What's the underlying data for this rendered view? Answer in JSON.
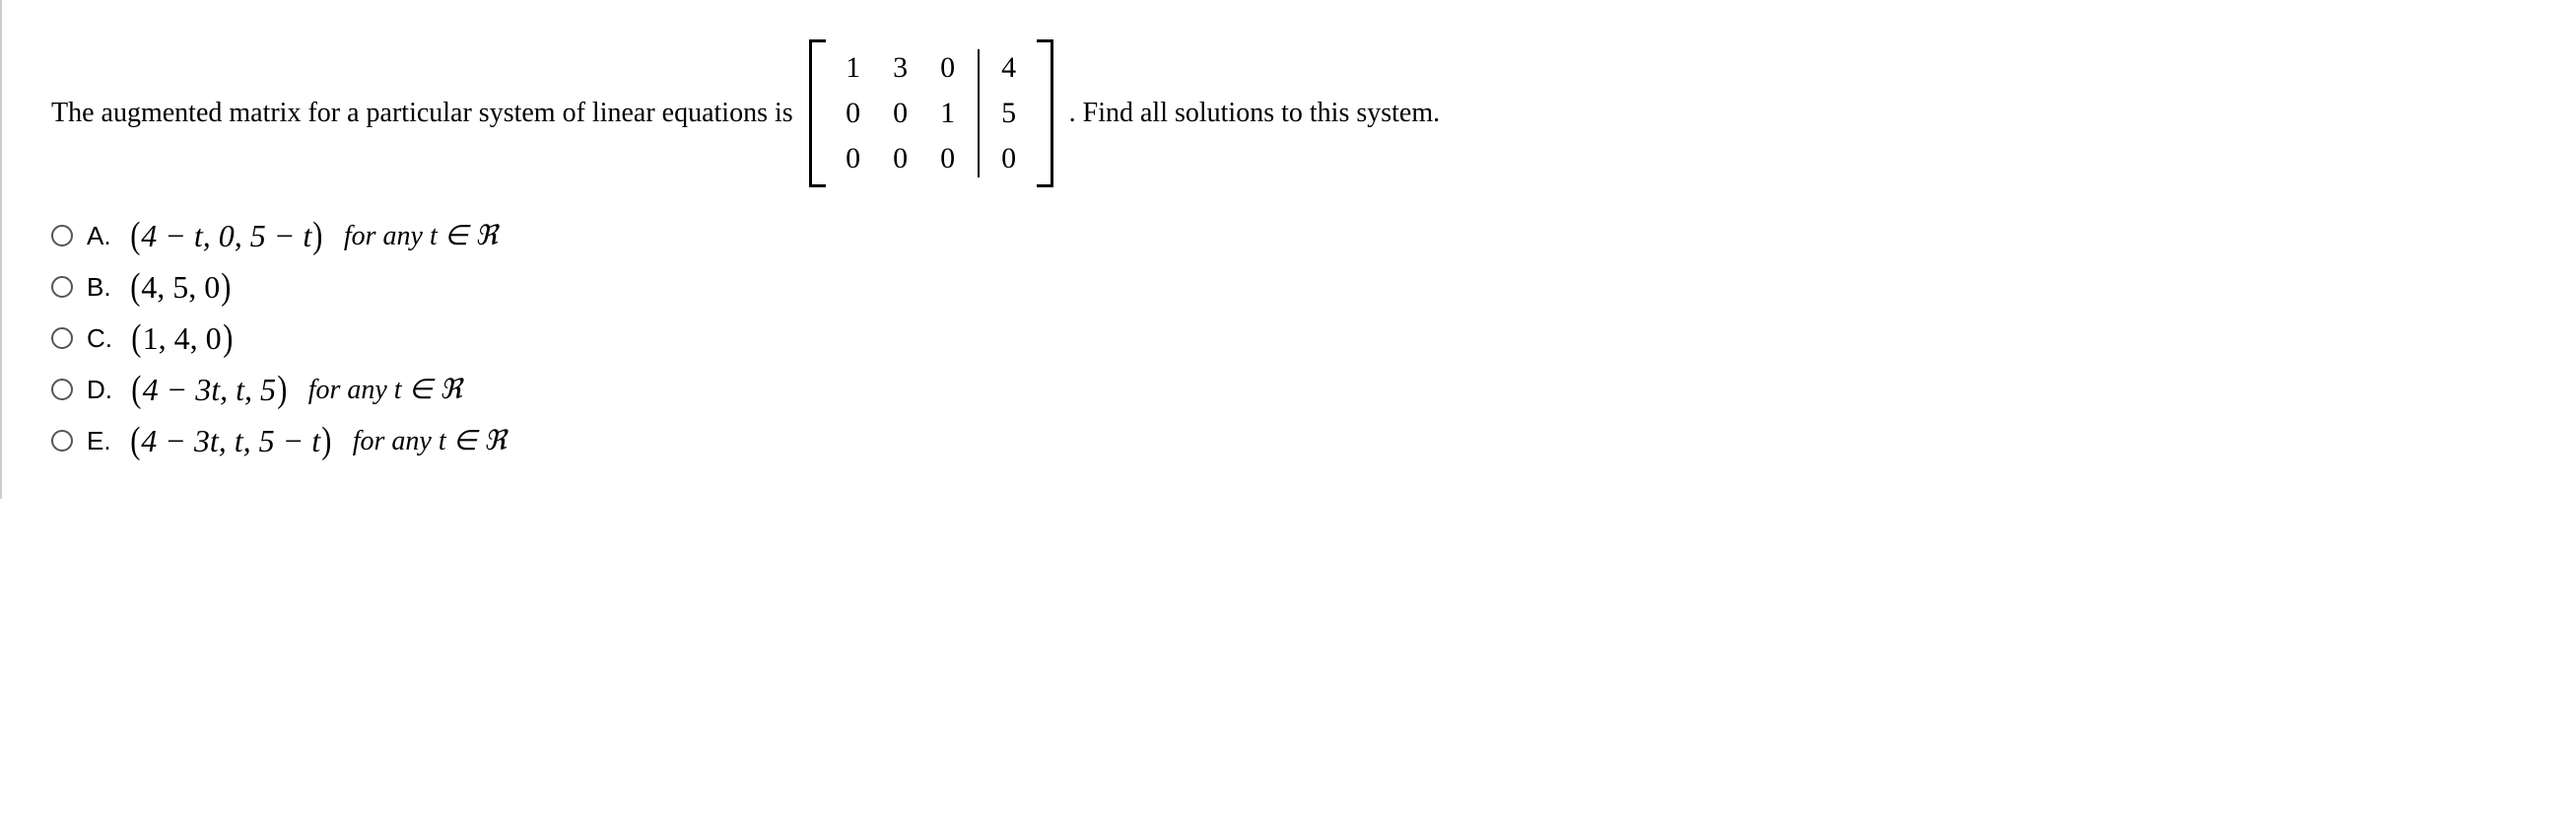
{
  "question": {
    "lead": "The augmented matrix for a particular system of linear equations is",
    "tail": ". Find all solutions to this system.",
    "matrix": {
      "left": [
        [
          "1",
          "3",
          "0"
        ],
        [
          "0",
          "0",
          "1"
        ],
        [
          "0",
          "0",
          "0"
        ]
      ],
      "right": [
        [
          "4"
        ],
        [
          "5"
        ],
        [
          "0"
        ]
      ]
    }
  },
  "options": {
    "A": {
      "label": "A.",
      "tuple": "4 − t, 0, 5 − t",
      "suffix": " for any t ∈ ℜ"
    },
    "B": {
      "label": "B.",
      "tuple": "4, 5, 0",
      "suffix": ""
    },
    "C": {
      "label": "C.",
      "tuple": "1, 4, 0",
      "suffix": ""
    },
    "D": {
      "label": "D.",
      "tuple": "4 − 3t, t, 5",
      "suffix": " for any t ∈ ℜ"
    },
    "E": {
      "label": "E.",
      "tuple": "4 − 3t, t, 5 − t",
      "suffix": " for any t ∈ ℜ"
    }
  }
}
